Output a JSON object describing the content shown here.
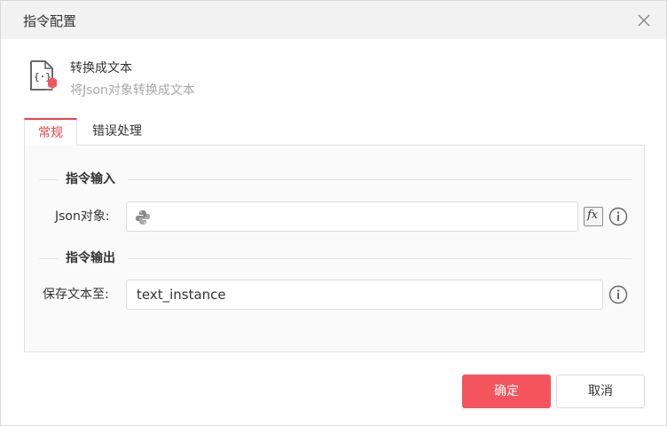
{
  "dialog": {
    "title": "指令配置"
  },
  "command": {
    "name": "转换成文本",
    "description": "将Json对象转换成文本"
  },
  "tabs": [
    {
      "label": "常规",
      "active": true
    },
    {
      "label": "错误处理",
      "active": false
    }
  ],
  "input_section": {
    "title": "指令输入",
    "fields": [
      {
        "label": "Json对象:",
        "value": "",
        "icon": "python-icon"
      }
    ]
  },
  "output_section": {
    "title": "指令输出",
    "fields": [
      {
        "label": "保存文本至:",
        "value": "text_instance"
      }
    ]
  },
  "footer": {
    "ok_label": "确定",
    "cancel_label": "取消"
  },
  "colors": {
    "accent": "#e8424b",
    "ok_button": "#f4545d",
    "title_bar": "#f2f2f2",
    "panel_bg": "#fafafa"
  }
}
